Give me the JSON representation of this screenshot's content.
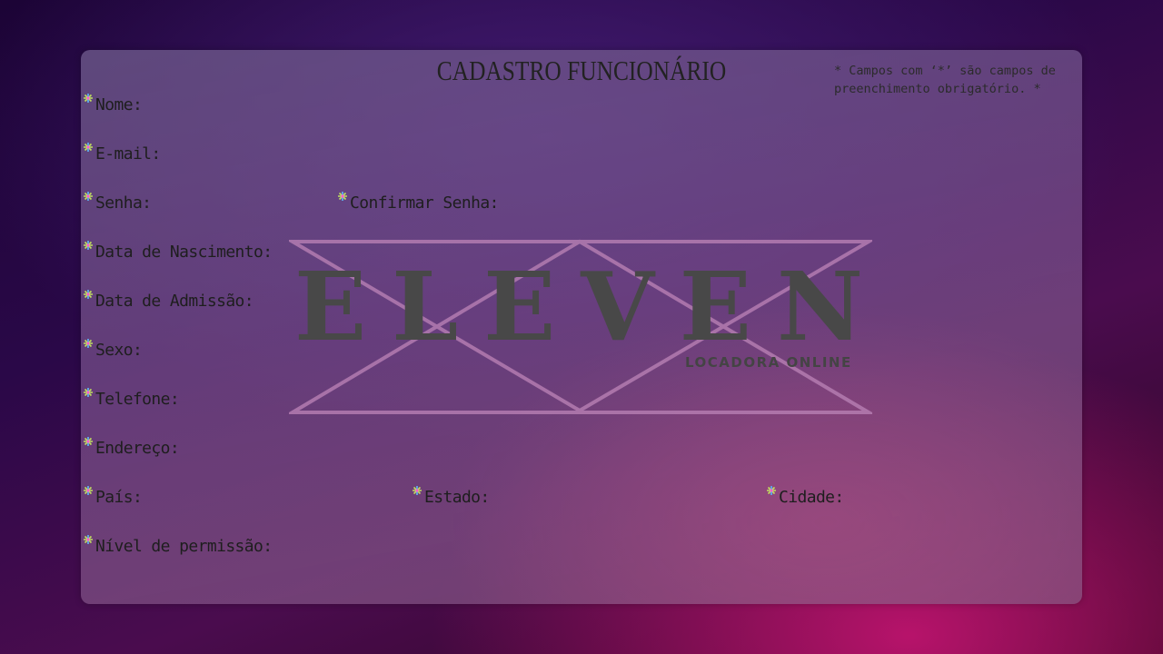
{
  "form": {
    "title": "CADASTRO FUNCIONÁRIO",
    "required_note": "* Campos com  ‘*’  são campos de\n  preenchimento obrigatório. *",
    "fields": {
      "nome": "Nome:",
      "email": "E-mail:",
      "senha": "Senha:",
      "confirmar_senha": "Confirmar Senha:",
      "data_nascimento": "Data de Nascimento:",
      "data_admissao": "Data de Admissão:",
      "sexo": "Sexo:",
      "telefone": "Telefone:",
      "endereco": "Endereço:",
      "pais": "País:",
      "estado": "Estado:",
      "cidade": "Cidade:",
      "nivel_permissao": "Nível de permissão:"
    },
    "required_icon": "colored-asterisk-icon"
  },
  "logo": {
    "brand_name": "ELEVEN",
    "tagline": "LOCADORA ONLINE"
  },
  "colors": {
    "panel": "#6e5a8c",
    "text": "#1e1e1e",
    "logo_text": "#444444",
    "logo_lines": "#b477b0",
    "background_dark": "#1c0436",
    "background_accent": "#be146e"
  }
}
